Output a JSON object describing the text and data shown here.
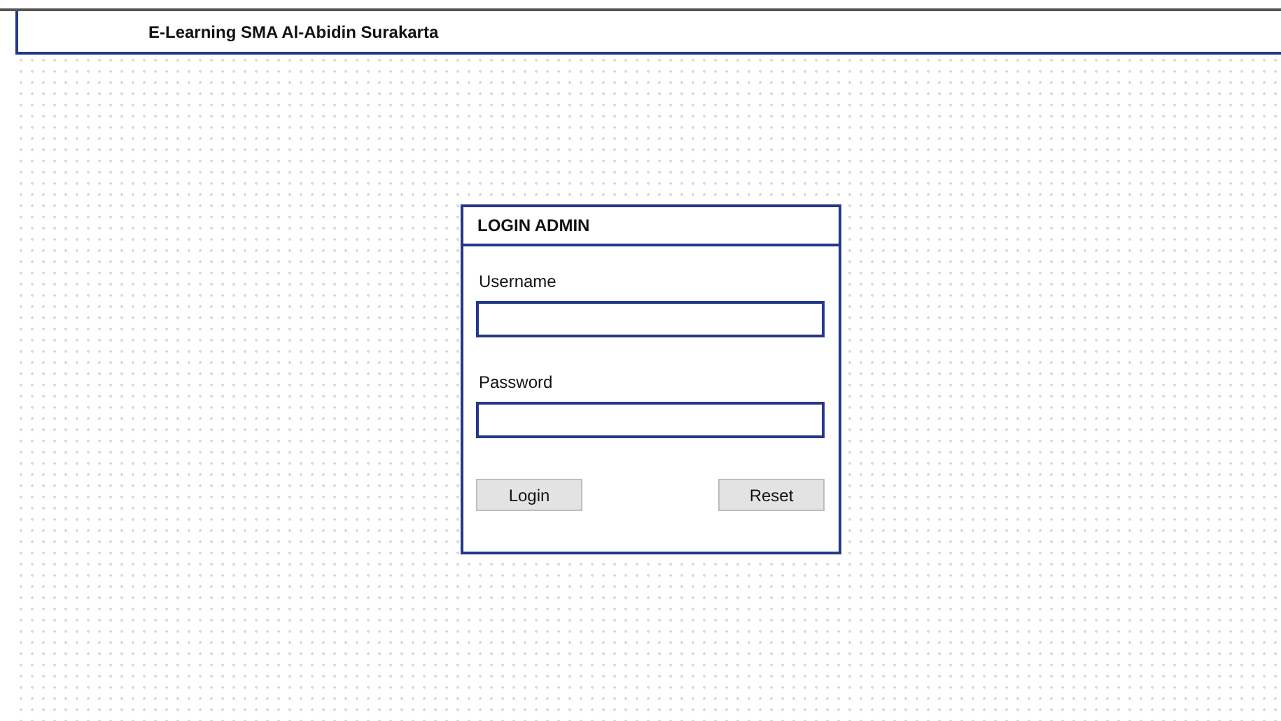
{
  "header": {
    "title": "E-Learning SMA Al-Abidin Surakarta"
  },
  "login_panel": {
    "title": "LOGIN ADMIN",
    "fields": [
      {
        "label": "Username"
      },
      {
        "label": "Password"
      }
    ],
    "buttons": [
      {
        "label": "Login"
      },
      {
        "label": "Reset"
      }
    ]
  }
}
